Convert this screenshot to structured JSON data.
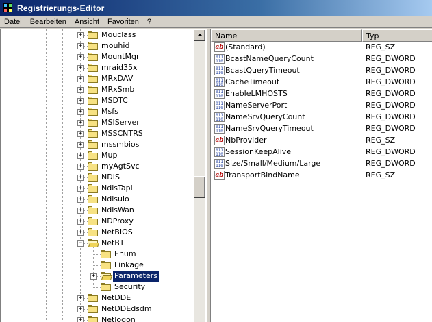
{
  "window": {
    "title": "Registrierungs-Editor"
  },
  "menu": [
    {
      "label": "Datei",
      "accel": "D",
      "rest": "atei"
    },
    {
      "label": "Bearbeiten",
      "accel": "B",
      "rest": "earbeiten"
    },
    {
      "label": "Ansicht",
      "accel": "A",
      "rest": "nsicht"
    },
    {
      "label": "Favoriten",
      "accel": "F",
      "rest": "avoriten"
    },
    {
      "label": "?",
      "accel": "?",
      "rest": ""
    }
  ],
  "tree": {
    "nodes": [
      {
        "label": "Mouclass",
        "level": 0,
        "expander": "+",
        "open": false,
        "selected": false
      },
      {
        "label": "mouhid",
        "level": 0,
        "expander": "+",
        "open": false,
        "selected": false
      },
      {
        "label": "MountMgr",
        "level": 0,
        "expander": "+",
        "open": false,
        "selected": false
      },
      {
        "label": "mraid35x",
        "level": 0,
        "expander": "+",
        "open": false,
        "selected": false
      },
      {
        "label": "MRxDAV",
        "level": 0,
        "expander": "+",
        "open": false,
        "selected": false
      },
      {
        "label": "MRxSmb",
        "level": 0,
        "expander": "+",
        "open": false,
        "selected": false
      },
      {
        "label": "MSDTC",
        "level": 0,
        "expander": "+",
        "open": false,
        "selected": false
      },
      {
        "label": "Msfs",
        "level": 0,
        "expander": "+",
        "open": false,
        "selected": false
      },
      {
        "label": "MSIServer",
        "level": 0,
        "expander": "+",
        "open": false,
        "selected": false
      },
      {
        "label": "MSSCNTRS",
        "level": 0,
        "expander": "+",
        "open": false,
        "selected": false
      },
      {
        "label": "mssmbios",
        "level": 0,
        "expander": "+",
        "open": false,
        "selected": false
      },
      {
        "label": "Mup",
        "level": 0,
        "expander": "+",
        "open": false,
        "selected": false
      },
      {
        "label": "myAgtSvc",
        "level": 0,
        "expander": "+",
        "open": false,
        "selected": false
      },
      {
        "label": "NDIS",
        "level": 0,
        "expander": "+",
        "open": false,
        "selected": false
      },
      {
        "label": "NdisTapi",
        "level": 0,
        "expander": "+",
        "open": false,
        "selected": false
      },
      {
        "label": "Ndisuio",
        "level": 0,
        "expander": "+",
        "open": false,
        "selected": false
      },
      {
        "label": "NdisWan",
        "level": 0,
        "expander": "+",
        "open": false,
        "selected": false
      },
      {
        "label": "NDProxy",
        "level": 0,
        "expander": "+",
        "open": false,
        "selected": false
      },
      {
        "label": "NetBIOS",
        "level": 0,
        "expander": "+",
        "open": false,
        "selected": false
      },
      {
        "label": "NetBT",
        "level": 0,
        "expander": "-",
        "open": true,
        "selected": false
      },
      {
        "label": "Enum",
        "level": 1,
        "expander": "",
        "open": false,
        "selected": false
      },
      {
        "label": "Linkage",
        "level": 1,
        "expander": "",
        "open": false,
        "selected": false
      },
      {
        "label": "Parameters",
        "level": 1,
        "expander": "+",
        "open": true,
        "selected": true
      },
      {
        "label": "Security",
        "level": 1,
        "expander": "",
        "open": false,
        "selected": false
      },
      {
        "label": "NetDDE",
        "level": 0,
        "expander": "+",
        "open": false,
        "selected": false
      },
      {
        "label": "NetDDEdsdm",
        "level": 0,
        "expander": "+",
        "open": false,
        "selected": false
      },
      {
        "label": "Netlogon",
        "level": 0,
        "expander": "+",
        "open": false,
        "selected": false
      }
    ]
  },
  "list": {
    "columns": [
      {
        "label": "Name"
      },
      {
        "label": "Typ"
      }
    ],
    "rows": [
      {
        "name": "(Standard)",
        "type": "REG_SZ",
        "icon": "string-value-icon",
        "kind": "sz"
      },
      {
        "name": "BcastNameQueryCount",
        "type": "REG_DWORD",
        "icon": "binary-value-icon",
        "kind": "dw"
      },
      {
        "name": "BcastQueryTimeout",
        "type": "REG_DWORD",
        "icon": "binary-value-icon",
        "kind": "dw"
      },
      {
        "name": "CacheTimeout",
        "type": "REG_DWORD",
        "icon": "binary-value-icon",
        "kind": "dw"
      },
      {
        "name": "EnableLMHOSTS",
        "type": "REG_DWORD",
        "icon": "binary-value-icon",
        "kind": "dw"
      },
      {
        "name": "NameServerPort",
        "type": "REG_DWORD",
        "icon": "binary-value-icon",
        "kind": "dw"
      },
      {
        "name": "NameSrvQueryCount",
        "type": "REG_DWORD",
        "icon": "binary-value-icon",
        "kind": "dw"
      },
      {
        "name": "NameSrvQueryTimeout",
        "type": "REG_DWORD",
        "icon": "binary-value-icon",
        "kind": "dw"
      },
      {
        "name": "NbProvider",
        "type": "REG_SZ",
        "icon": "string-value-icon",
        "kind": "sz"
      },
      {
        "name": "SessionKeepAlive",
        "type": "REG_DWORD",
        "icon": "binary-value-icon",
        "kind": "dw"
      },
      {
        "name": "Size/Small/Medium/Large",
        "type": "REG_DWORD",
        "icon": "binary-value-icon",
        "kind": "dw"
      },
      {
        "name": "TransportBindName",
        "type": "REG_SZ",
        "icon": "string-value-icon",
        "kind": "sz"
      }
    ]
  },
  "colors": {
    "titlebar_start": "#0a246a",
    "titlebar_end": "#a6caf0",
    "selection": "#0a246a",
    "folder": "#f7e283",
    "chrome": "#d4d0c8"
  }
}
